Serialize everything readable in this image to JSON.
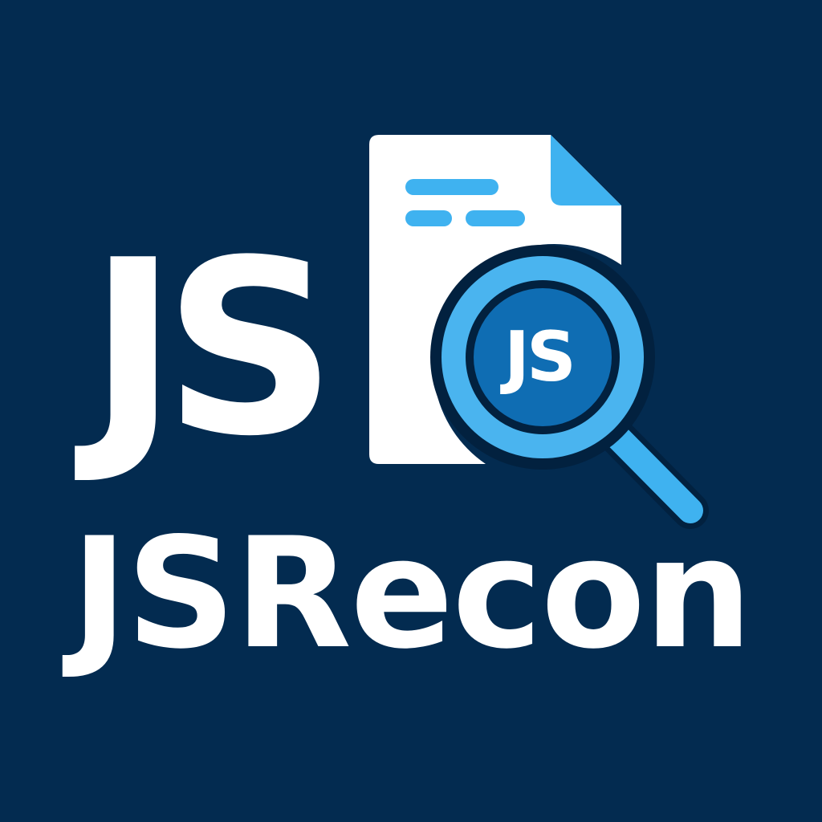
{
  "logo": {
    "big_text": "JS",
    "lens_text": "JS",
    "wordmark": "JSRecon"
  },
  "colors": {
    "background": "#032b50",
    "text": "#ffffff",
    "document": "#ffffff",
    "accent_light": "#3fb2f0",
    "lens_ring": "#4ab4ef",
    "lens_fill": "#0f6db3",
    "outline": "#02213f"
  },
  "icons": {
    "document": "document-icon",
    "magnifier": "magnifying-glass-icon"
  }
}
